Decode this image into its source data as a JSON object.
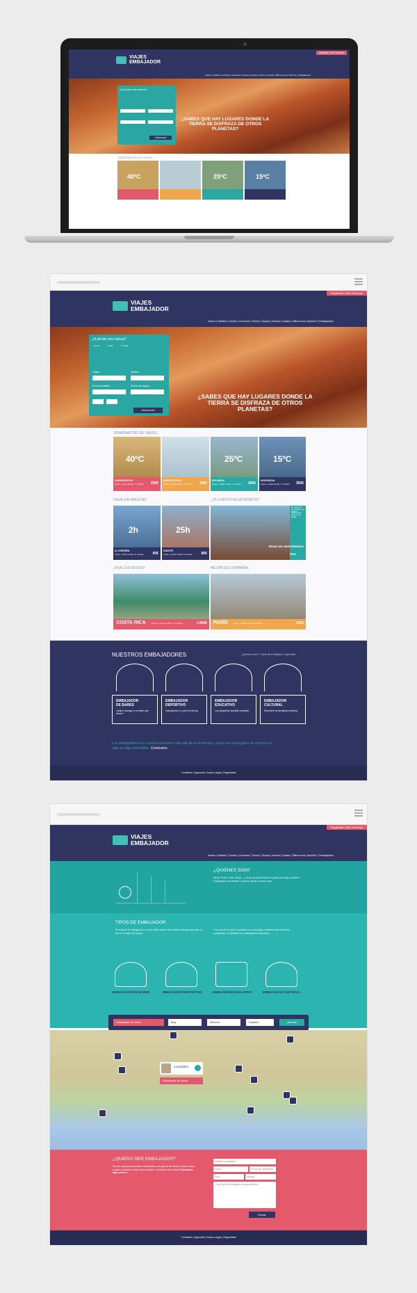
{
  "site": {
    "logo_line1": "VIAJES",
    "logo_line2": "EMBAJADOR",
    "top_link": "Registrate | Mis Reservas",
    "menu": "Vuelos | Hoteles | Coches | Cruceros | Trenes | Grupos | Novios | Costas | Última hora | Imprimir | Embajadores",
    "hero_headline": "¿Sabes que hay lugares donde la tierra se disfraza de otros planetas?",
    "search_title": "¿A dónde nos vamos?",
    "search_submit": "¡Vámonos!",
    "search_labels": [
      "Origen",
      "Destino",
      "Fecha de salida",
      "Fecha de regreso"
    ]
  },
  "thermometer": {
    "title": "TERMÓMETRO DE VIAJES",
    "cards": [
      {
        "temp": "40ºC",
        "place": "MARRUECOS",
        "sub": "Vuelo + Hotel 8 días / 7 noches",
        "price": "250€",
        "color": "#e4596b"
      },
      {
        "temp": "",
        "place": "BARCELONA",
        "sub": "Vuelo + Hotel 8 días / 7 noches",
        "price": "250€",
        "color": "#f0a64a"
      },
      {
        "temp": "25ºC",
        "place": "IRLANDA",
        "sub": "Vuelo + Hotel 8 días / 7 noches",
        "price": "350€",
        "color": "#29a9a4"
      },
      {
        "temp": "15ºC",
        "place": "NORUEGA",
        "sub": "Vuelo + Hotel 8 días / 7 noches",
        "price": "350€",
        "color": "#2f3560"
      }
    ]
  },
  "sections": {
    "viaja": "VIAJA SIN MALETAS",
    "bonito": "¿TE CUENTO ALGO BONITO?",
    "novios": "¡VIVA LOS NOVIOS!",
    "compania": "MEJOR EN COMPAÑÍA"
  },
  "promo": [
    {
      "time": "2h",
      "place": "A CORUÑA",
      "sub": "Vuelo + Hotel 3 días / 2 noches",
      "price": "50€"
    },
    {
      "time": "25h",
      "place": "GANTE",
      "sub": "Vuelo + Hotel 3 días / 2 noches",
      "price": "80€"
    }
  ],
  "bonito_box": {
    "text": "En septiembre las ciudades que bañan el Mediterráneo celebran sus fiestas",
    "place": "BRISAS DEL MEDITERRÁNEO",
    "sub": "Vuelo + Hotel 5 días / 4 noches",
    "price": "550€"
  },
  "wide": [
    {
      "place": "COSTA RICA",
      "sub": "Vuelo + Hotel 15 días / 14 noches",
      "price": "1.500€"
    },
    {
      "place": "PARÍS",
      "sub": "Vuelo + Hotel 4 días / 3 noches",
      "price": "150€"
    }
  ],
  "embajadores": {
    "title": "NUESTROS EMBAJADORES",
    "links": "¿Quiénes son? | Tipos de Embajador | Apúntate",
    "roles": [
      {
        "t1": "EMBAJADOR",
        "t2": "DE BARES",
        "d": "¿Sabe navegar y no sabe que hacer?"
      },
      {
        "t1": "EMBAJADOR",
        "t2": "DEPORTIVO",
        "d": "¡Vacaciones sí, pero en forma."
      },
      {
        "t1": "EMBAJADOR",
        "t2": "EDUCATIVO",
        "d": "Los pequeños también cuentan."
      },
      {
        "t1": "EMBAJADOR",
        "t2": "CULTURAL",
        "d": "Descubre la verdadera historia."
      }
    ],
    "claim": "Los embajadores son nuestra extensión más allá de las fronteras y serán los encargados de convertir tu viaje en algo inolvidable.",
    "claim_link": "Conócelos."
  },
  "footer": "Contacto | Agencia | Aviso Legal | Seguridad",
  "quienes": {
    "title": "¿QUIÉNES SON?",
    "text": "María, Pedro, Marc, Borja... y otros son gente llena de ganas de viajar, nuestros embajadores de Madrid, Londres, Berlín y Nueva York..."
  },
  "tipos": {
    "title": "TIPOS DE EMBAJADOR",
    "text_left": "Se trata de el embajador y con los suffle carles, los establecimientos opinarán el bar en un sitio del mundo.",
    "text_right": "Y si eres de los que no puedes con el bowling evidentemente todos los campeones, contáctate con embajadores deportivos.",
    "roles": [
      "EMBAJADOR DE BARES",
      "EMBAJADOR DEPORTIVO",
      "EMBAJADOR EDUCATIVO",
      "EMBAJADOR CULTURAL"
    ]
  },
  "filter": {
    "type": "Embajador de bares",
    "country": "Italy",
    "city": "Genova",
    "lang": "Español",
    "go": "¡Buscar!"
  },
  "map_popup": {
    "name": "Lucandres",
    "sub": "...",
    "tag": "Embajador de bares"
  },
  "join": {
    "title": "¿QUIERO SER EMBAJADOR?",
    "text": "Si eres una persona activa, extrovertida, con ganas de conocer gente nueva y sabes mostrar lo mejor de tu ciudad, ¡Cuéntanos sin rodeos!",
    "link": "Cuéntanos algo sobre ti.",
    "fields": [
      "Nombre y apellidos",
      "Email",
      "Fecha de nacimiento",
      "País",
      "Ciudad",
      "¿Qué tipo de Embajador te gustaría ser?"
    ],
    "submit": "Enviar"
  }
}
